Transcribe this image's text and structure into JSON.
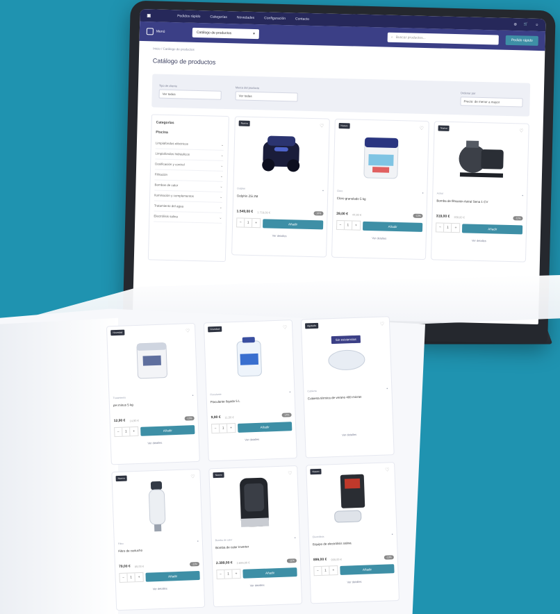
{
  "header": {
    "nav": [
      "Pedidos rápido",
      "Categorías",
      "Novedades",
      "Configuración",
      "Contacto"
    ],
    "menu_label": "Menú",
    "catalog_select": "Catálogo de productos",
    "search_placeholder": "Buscar productos...",
    "order_button": "Pedido rápido"
  },
  "main": {
    "breadcrumb": "Inicio / Catálogo de productos",
    "title": "Catálogo de productos",
    "filters": [
      {
        "label": "Tipo de cliente",
        "value": "Ver todos"
      },
      {
        "label": "Marca del producto",
        "value": "Ver todas"
      },
      {
        "label": "Ordenar por",
        "value": "Precio: de menor a mayor"
      }
    ]
  },
  "sidebar": {
    "heading": "Categorías",
    "sub": "Piscina",
    "items": [
      "Limpiafondos eléctricos",
      "Limpiafondos hidráulicos",
      "Dosificación y control",
      "Filtración",
      "Bombas de calor",
      "Iluminación y complementos",
      "Tratamiento del agua",
      "Electrólisis salina"
    ]
  },
  "cards": [
    {
      "badge": "Nuevo",
      "brand": "Dolphin",
      "name": "Dolphin Z5i 2M",
      "price": "1.549,00 €",
      "old": "1.719,00 €",
      "disc": "-10%",
      "more": "Ver detalles"
    },
    {
      "badge": "Nuevo",
      "brand": "Cloro",
      "name": "Cloro granulado 5 kg",
      "price": "39,00 €",
      "old": "44,90 €",
      "disc": "-13%",
      "more": "Ver detalles"
    },
    {
      "badge": "Nuevo",
      "brand": "Astral",
      "name": "Bomba de filtración Astral Sena 1 CV",
      "price": "319,00 €",
      "old": "359,00 €",
      "disc": "-11%",
      "more": "Ver detalles"
    }
  ],
  "sheet_cards": [
    {
      "badge": "Novedad",
      "brand": "Tratamiento",
      "name": "pH minus 5 kg",
      "price": "12,90 €",
      "old": "14,90 €",
      "disc": "-13%",
      "more": "Ver detalles"
    },
    {
      "badge": "Novedad",
      "brand": "Floculante",
      "name": "Floculante líquido 5 L",
      "price": "9,90 €",
      "old": "11,50 €",
      "disc": "-14%",
      "more": "Ver detalles"
    },
    {
      "badge": "Agotado",
      "brand": "Cubierta",
      "name": "Cubierta térmica de verano 400 micras",
      "price": "",
      "old": "",
      "disc": "-12%",
      "more": "Ver detalles",
      "label": "Sin existencias"
    },
    {
      "badge": "Nuevo",
      "brand": "Filtro",
      "name": "Filtro de cartucho",
      "price": "79,00 €",
      "old": "89,00 €",
      "disc": "-11%",
      "more": "Ver detalles"
    },
    {
      "badge": "Nuevo",
      "brand": "Bomba de calor",
      "name": "Bomba de calor Inverter",
      "price": "2.399,00 €",
      "old": "2.699,00 €",
      "disc": "-11%",
      "more": "Ver detalles"
    },
    {
      "badge": "Nuevo",
      "brand": "Electrólisis",
      "name": "Equipo de electrólisis salina",
      "price": "899,00 €",
      "old": "999,00 €",
      "disc": "-10%",
      "more": "Ver detalles"
    }
  ],
  "labels": {
    "buy": "Añadir",
    "qty_minus": "−",
    "qty_value": "1",
    "qty_plus": "+"
  },
  "colors": {
    "background": "#1f93b0",
    "header": "#26285a",
    "accent": "#3e8fa6"
  }
}
